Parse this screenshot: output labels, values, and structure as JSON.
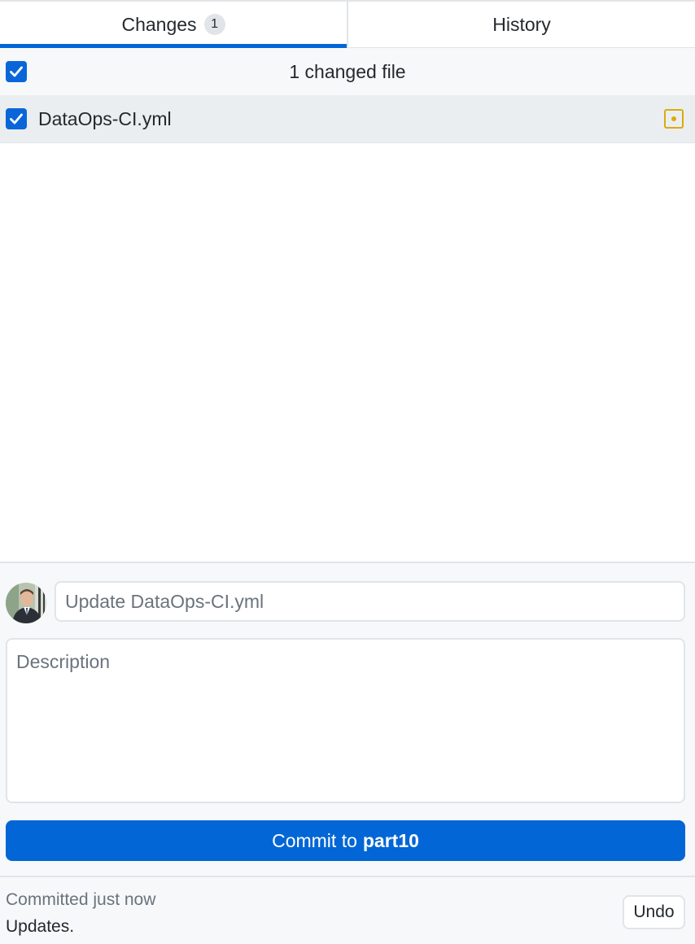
{
  "tabs": {
    "changes_label": "Changes",
    "changes_count": "1",
    "history_label": "History"
  },
  "file_list": {
    "header_label": "1 changed file",
    "all_selected": true,
    "files": [
      {
        "name": "DataOps-CI.yml",
        "selected": true,
        "status": "modified"
      }
    ]
  },
  "commit": {
    "summary_placeholder": "Update DataOps-CI.yml",
    "description_placeholder": "Description",
    "button_prefix": "Commit to",
    "branch": "part10"
  },
  "last_commit": {
    "label": "Committed just now",
    "summary": "Updates.",
    "undo_label": "Undo"
  },
  "colors": {
    "accent": "#0366d6",
    "checkbox": "#0a66d8",
    "modified": "#dbab09"
  },
  "icons": {
    "checkbox": "checkmark-icon",
    "file_status": "file-modified-icon"
  }
}
